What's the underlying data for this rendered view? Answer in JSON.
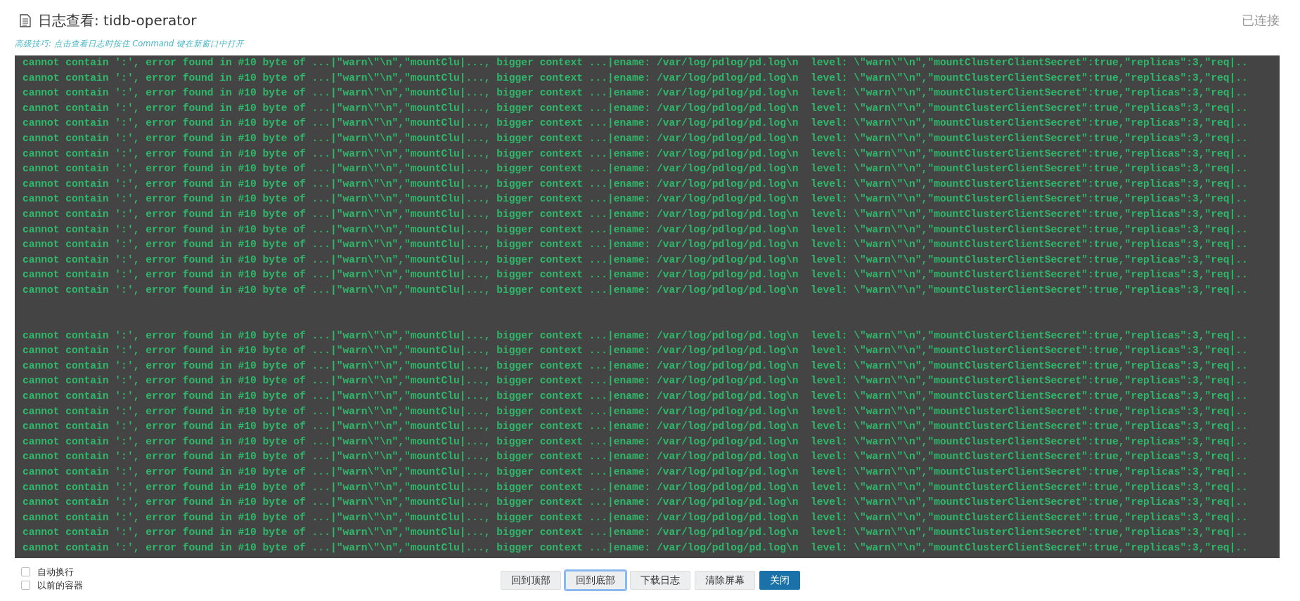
{
  "header": {
    "title": "日志查看: tidb-operator",
    "status": "已连接",
    "hint": "高级技巧: 点击查看日志时按住 Command 键在新窗口中打开"
  },
  "log": {
    "groups": [
      [
        "cannot contain ':', error found in #10 byte of ...|\"warn\\\"\\n\",\"mountClu|..., bigger context ...|ename: /var/log/pdlog/pd.log\\n  level: \\\"warn\\\"\\n\",\"mountClusterClientSecret\":true,\"replicas\":3,\"req|..",
        "cannot contain ':', error found in #10 byte of ...|\"warn\\\"\\n\",\"mountClu|..., bigger context ...|ename: /var/log/pdlog/pd.log\\n  level: \\\"warn\\\"\\n\",\"mountClusterClientSecret\":true,\"replicas\":3,\"req|..",
        "cannot contain ':', error found in #10 byte of ...|\"warn\\\"\\n\",\"mountClu|..., bigger context ...|ename: /var/log/pdlog/pd.log\\n  level: \\\"warn\\\"\\n\",\"mountClusterClientSecret\":true,\"replicas\":3,\"req|..",
        "cannot contain ':', error found in #10 byte of ...|\"warn\\\"\\n\",\"mountClu|..., bigger context ...|ename: /var/log/pdlog/pd.log\\n  level: \\\"warn\\\"\\n\",\"mountClusterClientSecret\":true,\"replicas\":3,\"req|..",
        "cannot contain ':', error found in #10 byte of ...|\"warn\\\"\\n\",\"mountClu|..., bigger context ...|ename: /var/log/pdlog/pd.log\\n  level: \\\"warn\\\"\\n\",\"mountClusterClientSecret\":true,\"replicas\":3,\"req|..",
        "cannot contain ':', error found in #10 byte of ...|\"warn\\\"\\n\",\"mountClu|..., bigger context ...|ename: /var/log/pdlog/pd.log\\n  level: \\\"warn\\\"\\n\",\"mountClusterClientSecret\":true,\"replicas\":3,\"req|..",
        "cannot contain ':', error found in #10 byte of ...|\"warn\\\"\\n\",\"mountClu|..., bigger context ...|ename: /var/log/pdlog/pd.log\\n  level: \\\"warn\\\"\\n\",\"mountClusterClientSecret\":true,\"replicas\":3,\"req|..",
        "cannot contain ':', error found in #10 byte of ...|\"warn\\\"\\n\",\"mountClu|..., bigger context ...|ename: /var/log/pdlog/pd.log\\n  level: \\\"warn\\\"\\n\",\"mountClusterClientSecret\":true,\"replicas\":3,\"req|..",
        "cannot contain ':', error found in #10 byte of ...|\"warn\\\"\\n\",\"mountClu|..., bigger context ...|ename: /var/log/pdlog/pd.log\\n  level: \\\"warn\\\"\\n\",\"mountClusterClientSecret\":true,\"replicas\":3,\"req|..",
        "cannot contain ':', error found in #10 byte of ...|\"warn\\\"\\n\",\"mountClu|..., bigger context ...|ename: /var/log/pdlog/pd.log\\n  level: \\\"warn\\\"\\n\",\"mountClusterClientSecret\":true,\"replicas\":3,\"req|..",
        "cannot contain ':', error found in #10 byte of ...|\"warn\\\"\\n\",\"mountClu|..., bigger context ...|ename: /var/log/pdlog/pd.log\\n  level: \\\"warn\\\"\\n\",\"mountClusterClientSecret\":true,\"replicas\":3,\"req|..",
        "cannot contain ':', error found in #10 byte of ...|\"warn\\\"\\n\",\"mountClu|..., bigger context ...|ename: /var/log/pdlog/pd.log\\n  level: \\\"warn\\\"\\n\",\"mountClusterClientSecret\":true,\"replicas\":3,\"req|..",
        "cannot contain ':', error found in #10 byte of ...|\"warn\\\"\\n\",\"mountClu|..., bigger context ...|ename: /var/log/pdlog/pd.log\\n  level: \\\"warn\\\"\\n\",\"mountClusterClientSecret\":true,\"replicas\":3,\"req|..",
        "cannot contain ':', error found in #10 byte of ...|\"warn\\\"\\n\",\"mountClu|..., bigger context ...|ename: /var/log/pdlog/pd.log\\n  level: \\\"warn\\\"\\n\",\"mountClusterClientSecret\":true,\"replicas\":3,\"req|..",
        "cannot contain ':', error found in #10 byte of ...|\"warn\\\"\\n\",\"mountClu|..., bigger context ...|ename: /var/log/pdlog/pd.log\\n  level: \\\"warn\\\"\\n\",\"mountClusterClientSecret\":true,\"replicas\":3,\"req|..",
        "cannot contain ':', error found in #10 byte of ...|\"warn\\\"\\n\",\"mountClu|..., bigger context ...|ename: /var/log/pdlog/pd.log\\n  level: \\\"warn\\\"\\n\",\"mountClusterClientSecret\":true,\"replicas\":3,\"req|.."
      ],
      [
        "cannot contain ':', error found in #10 byte of ...|\"warn\\\"\\n\",\"mountClu|..., bigger context ...|ename: /var/log/pdlog/pd.log\\n  level: \\\"warn\\\"\\n\",\"mountClusterClientSecret\":true,\"replicas\":3,\"req|..",
        "cannot contain ':', error found in #10 byte of ...|\"warn\\\"\\n\",\"mountClu|..., bigger context ...|ename: /var/log/pdlog/pd.log\\n  level: \\\"warn\\\"\\n\",\"mountClusterClientSecret\":true,\"replicas\":3,\"req|..",
        "cannot contain ':', error found in #10 byte of ...|\"warn\\\"\\n\",\"mountClu|..., bigger context ...|ename: /var/log/pdlog/pd.log\\n  level: \\\"warn\\\"\\n\",\"mountClusterClientSecret\":true,\"replicas\":3,\"req|..",
        "cannot contain ':', error found in #10 byte of ...|\"warn\\\"\\n\",\"mountClu|..., bigger context ...|ename: /var/log/pdlog/pd.log\\n  level: \\\"warn\\\"\\n\",\"mountClusterClientSecret\":true,\"replicas\":3,\"req|..",
        "cannot contain ':', error found in #10 byte of ...|\"warn\\\"\\n\",\"mountClu|..., bigger context ...|ename: /var/log/pdlog/pd.log\\n  level: \\\"warn\\\"\\n\",\"mountClusterClientSecret\":true,\"replicas\":3,\"req|..",
        "cannot contain ':', error found in #10 byte of ...|\"warn\\\"\\n\",\"mountClu|..., bigger context ...|ename: /var/log/pdlog/pd.log\\n  level: \\\"warn\\\"\\n\",\"mountClusterClientSecret\":true,\"replicas\":3,\"req|..",
        "cannot contain ':', error found in #10 byte of ...|\"warn\\\"\\n\",\"mountClu|..., bigger context ...|ename: /var/log/pdlog/pd.log\\n  level: \\\"warn\\\"\\n\",\"mountClusterClientSecret\":true,\"replicas\":3,\"req|..",
        "cannot contain ':', error found in #10 byte of ...|\"warn\\\"\\n\",\"mountClu|..., bigger context ...|ename: /var/log/pdlog/pd.log\\n  level: \\\"warn\\\"\\n\",\"mountClusterClientSecret\":true,\"replicas\":3,\"req|..",
        "cannot contain ':', error found in #10 byte of ...|\"warn\\\"\\n\",\"mountClu|..., bigger context ...|ename: /var/log/pdlog/pd.log\\n  level: \\\"warn\\\"\\n\",\"mountClusterClientSecret\":true,\"replicas\":3,\"req|..",
        "cannot contain ':', error found in #10 byte of ...|\"warn\\\"\\n\",\"mountClu|..., bigger context ...|ename: /var/log/pdlog/pd.log\\n  level: \\\"warn\\\"\\n\",\"mountClusterClientSecret\":true,\"replicas\":3,\"req|..",
        "cannot contain ':', error found in #10 byte of ...|\"warn\\\"\\n\",\"mountClu|..., bigger context ...|ename: /var/log/pdlog/pd.log\\n  level: \\\"warn\\\"\\n\",\"mountClusterClientSecret\":true,\"replicas\":3,\"req|..",
        "cannot contain ':', error found in #10 byte of ...|\"warn\\\"\\n\",\"mountClu|..., bigger context ...|ename: /var/log/pdlog/pd.log\\n  level: \\\"warn\\\"\\n\",\"mountClusterClientSecret\":true,\"replicas\":3,\"req|..",
        "cannot contain ':', error found in #10 byte of ...|\"warn\\\"\\n\",\"mountClu|..., bigger context ...|ename: /var/log/pdlog/pd.log\\n  level: \\\"warn\\\"\\n\",\"mountClusterClientSecret\":true,\"replicas\":3,\"req|..",
        "cannot contain ':', error found in #10 byte of ...|\"warn\\\"\\n\",\"mountClu|..., bigger context ...|ename: /var/log/pdlog/pd.log\\n  level: \\\"warn\\\"\\n\",\"mountClusterClientSecret\":true,\"replicas\":3,\"req|..",
        "cannot contain ':', error found in #10 byte of ...|\"warn\\\"\\n\",\"mountClu|..., bigger context ...|ename: /var/log/pdlog/pd.log\\n  level: \\\"warn\\\"\\n\",\"mountClusterClientSecret\":true,\"replicas\":3,\"req|.."
      ]
    ]
  },
  "options": [
    {
      "label": "自动换行",
      "checked": false
    },
    {
      "label": "以前的容器",
      "checked": false
    }
  ],
  "buttons": [
    {
      "label": "回到顶部",
      "kind": "default",
      "focused": false
    },
    {
      "label": "回到底部",
      "kind": "default",
      "focused": true
    },
    {
      "label": "下载日志",
      "kind": "default",
      "focused": false
    },
    {
      "label": "清除屏幕",
      "kind": "default",
      "focused": false
    },
    {
      "label": "关闭",
      "kind": "primary",
      "focused": false
    }
  ]
}
